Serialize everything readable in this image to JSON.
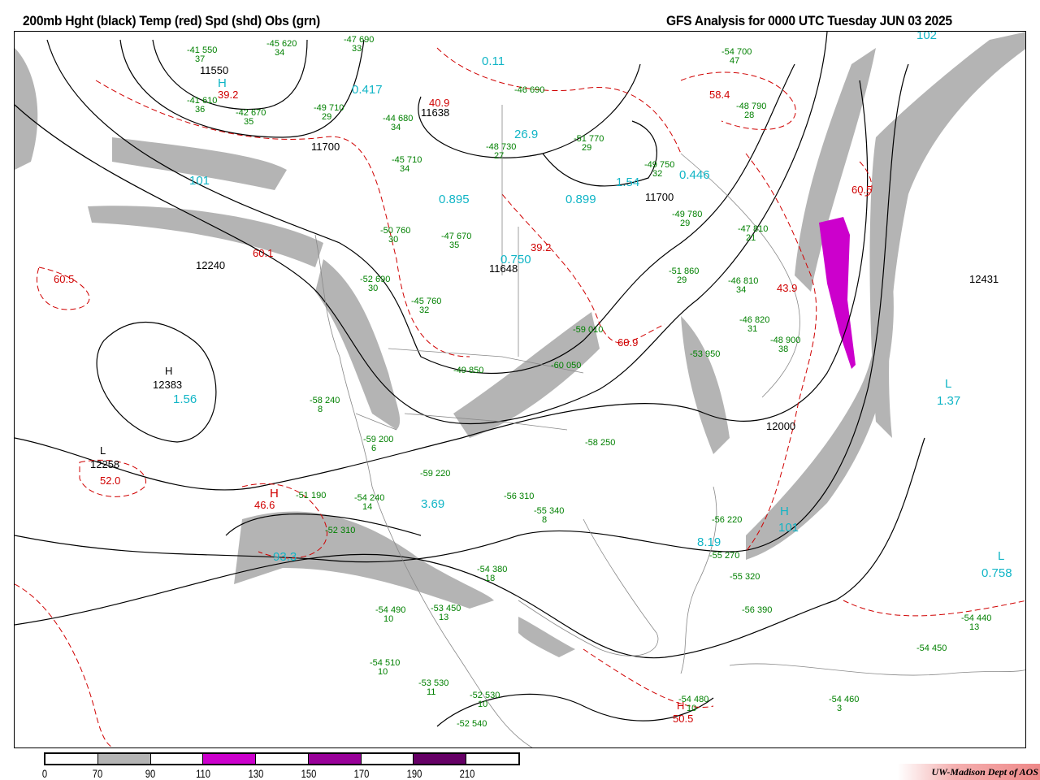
{
  "header": {
    "left_title": "200mb Hght (black) Temp (red) Spd (shd) Obs (grn)",
    "right_title": "GFS Analysis for 0000 UTC Tuesday  JUN 03 2025"
  },
  "colors": {
    "speed_70_90": "#b4b4b4",
    "speed_110_130": "#cc00cc",
    "speed_150_170": "#990099",
    "speed_190_210": "#660066",
    "height": "#000000",
    "temp": "#d00000",
    "obs": "#008000",
    "centers": "#11b5c6"
  },
  "colorbar": {
    "ticks": [
      "0",
      "70",
      "90",
      "110",
      "130",
      "150",
      "170",
      "190",
      "210"
    ]
  },
  "credit": "UW-Madison  Dept of AOS",
  "heights": [
    "11550",
    "11700",
    "11638",
    "11700",
    "11648",
    "12240",
    "12383",
    "12258",
    "12431",
    "12000"
  ],
  "centers": [
    {
      "t": "H",
      "v": "39.2"
    },
    {
      "t": "L",
      "v": "0.11"
    },
    {
      "t": "",
      "v": "0.417"
    },
    {
      "t": "L",
      "v": "101"
    },
    {
      "t": "L",
      "v": "60.5"
    },
    {
      "t": "H",
      "v": "1.56"
    },
    {
      "t": "L",
      "v": "52.0"
    },
    {
      "t": "H",
      "v": "46.6"
    },
    {
      "t": "H",
      "v": "93.3"
    },
    {
      "t": "",
      "v": "0.895"
    },
    {
      "t": "",
      "v": "0.899"
    },
    {
      "t": "L",
      "v": "26.9"
    },
    {
      "t": "",
      "v": "1.54"
    },
    {
      "t": "L",
      "v": "0.446"
    },
    {
      "t": "L",
      "v": "39.2"
    },
    {
      "t": "L",
      "v": "0.750"
    },
    {
      "t": "H",
      "v": "40.9"
    },
    {
      "t": "L",
      "v": "58.4"
    },
    {
      "t": "L",
      "v": "60.5"
    },
    {
      "t": "H",
      "v": "43.9"
    },
    {
      "t": "L",
      "v": "1.37"
    },
    {
      "t": "L",
      "v": "0.758"
    },
    {
      "t": "H",
      "v": "101"
    },
    {
      "t": "",
      "v": "8.19"
    },
    {
      "t": "",
      "v": "3.69"
    },
    {
      "t": "H",
      "v": "50.5"
    },
    {
      "t": "",
      "v": "60.1"
    },
    {
      "t": "",
      "v": "60.9"
    },
    {
      "t": "",
      "v": "102"
    }
  ],
  "obs": [
    {
      "t": "-41",
      "h": "550",
      "d": "37"
    },
    {
      "t": "-45",
      "h": "620",
      "d": "34"
    },
    {
      "t": "-47",
      "h": "690",
      "d": "33"
    },
    {
      "t": "-41",
      "h": "610",
      "d": "36"
    },
    {
      "t": "-42",
      "h": "670",
      "d": "35"
    },
    {
      "t": "-49",
      "h": "710",
      "d": "29"
    },
    {
      "t": "-44",
      "h": "680",
      "d": "34"
    },
    {
      "t": "-46",
      "h": "690",
      "d": ""
    },
    {
      "t": "-48",
      "h": "730",
      "d": "27"
    },
    {
      "t": "-51",
      "h": "770",
      "d": "29"
    },
    {
      "t": "-49",
      "h": "750",
      "d": "32"
    },
    {
      "t": "-54",
      "h": "700",
      "d": "47"
    },
    {
      "t": "-48",
      "h": "790",
      "d": "28"
    },
    {
      "t": "-45",
      "h": "710",
      "d": "34"
    },
    {
      "t": "-50",
      "h": "760",
      "d": "30"
    },
    {
      "t": "-47",
      "h": "670",
      "d": "35"
    },
    {
      "t": "-52",
      "h": "690",
      "d": "30"
    },
    {
      "t": "-45",
      "h": "760",
      "d": "32"
    },
    {
      "t": "-49",
      "h": "850",
      "d": ""
    },
    {
      "t": "-58",
      "h": "240",
      "d": "8"
    },
    {
      "t": "-59",
      "h": "200",
      "d": "6"
    },
    {
      "t": "-59",
      "h": "220",
      "d": ""
    },
    {
      "t": "-58",
      "h": "250",
      "d": ""
    },
    {
      "t": "-56",
      "h": "310",
      "d": ""
    },
    {
      "t": "-55",
      "h": "340",
      "d": "8"
    },
    {
      "t": "-54",
      "h": "380",
      "d": "18"
    },
    {
      "t": "-54",
      "h": "490",
      "d": "10"
    },
    {
      "t": "-53",
      "h": "450",
      "d": "13"
    },
    {
      "t": "-52",
      "h": "530",
      "d": "10"
    },
    {
      "t": "-52",
      "h": "540",
      "d": ""
    },
    {
      "t": "-54",
      "h": "510",
      "d": "10"
    },
    {
      "t": "-53",
      "h": "530",
      "d": "11"
    },
    {
      "t": "-54",
      "h": "480",
      "d": "10"
    },
    {
      "t": "-54",
      "h": "460",
      "d": "3"
    },
    {
      "t": "-54",
      "h": "450",
      "d": ""
    },
    {
      "t": "-54",
      "h": "440",
      "d": "13"
    },
    {
      "t": "-56",
      "h": "390",
      "d": ""
    },
    {
      "t": "-55",
      "h": "320",
      "d": ""
    },
    {
      "t": "-55",
      "h": "270",
      "d": ""
    },
    {
      "t": "-56",
      "h": "220",
      "d": ""
    },
    {
      "t": "-47",
      "h": "810",
      "d": "21"
    },
    {
      "t": "-46",
      "h": "810",
      "d": "34"
    },
    {
      "t": "-46",
      "h": "820",
      "d": "31"
    },
    {
      "t": "-48",
      "h": "900",
      "d": "38"
    },
    {
      "t": "-53",
      "h": "950",
      "d": ""
    },
    {
      "t": "-51",
      "h": "860",
      "d": "29"
    },
    {
      "t": "-49",
      "h": "780",
      "d": "29"
    },
    {
      "t": "-60",
      "h": "050",
      "d": ""
    },
    {
      "t": "-59",
      "h": "010",
      "d": ""
    },
    {
      "t": "-51",
      "h": "190",
      "d": ""
    },
    {
      "t": "-54",
      "h": "240",
      "d": "14"
    },
    {
      "t": "-52",
      "h": "310",
      "d": ""
    }
  ]
}
